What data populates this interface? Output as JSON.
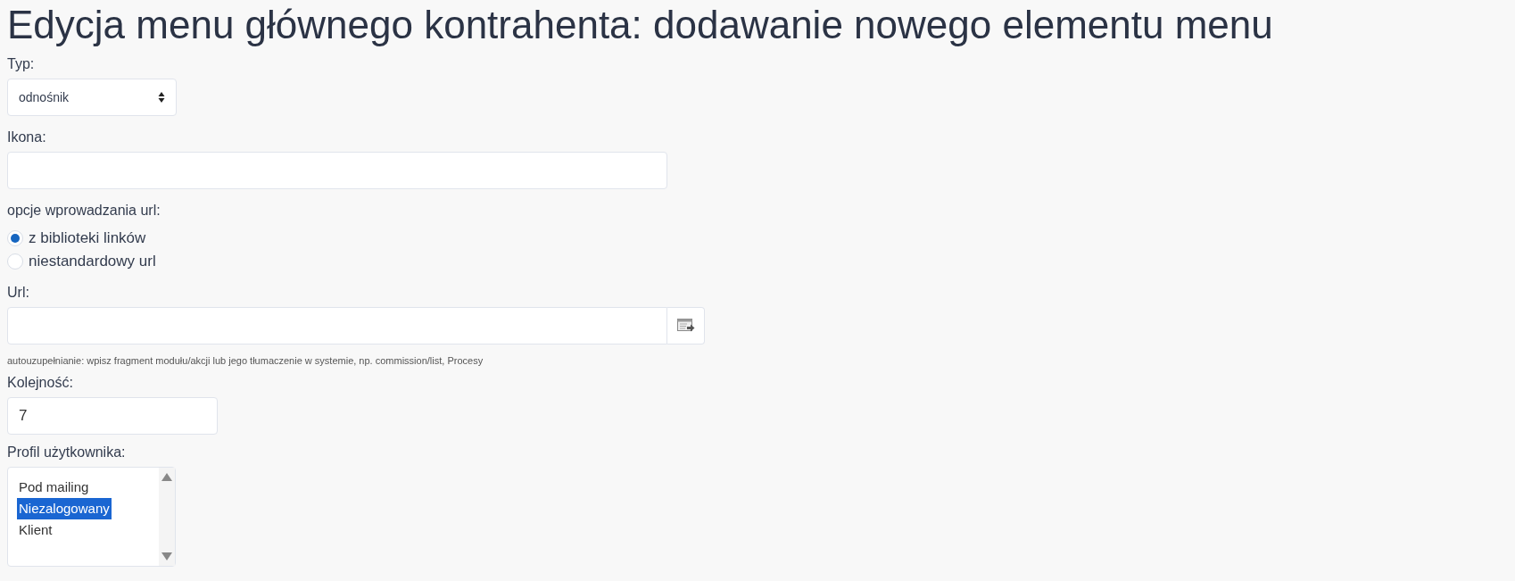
{
  "title": "Edycja menu głównego kontrahenta: dodawanie nowego elementu menu",
  "type_field": {
    "label": "Typ:",
    "value": "odnośnik"
  },
  "icon_field": {
    "label": "Ikona:"
  },
  "url_options": {
    "label": "opcje wprowadzania url:",
    "options": [
      {
        "label": "z biblioteki linków",
        "selected": true
      },
      {
        "label": "niestandardowy url",
        "selected": false
      }
    ]
  },
  "url_field": {
    "label": "Url:",
    "hint": "autouzupełnianie: wpisz fragment modułu/akcji lub jego tłumaczenie w systemie, np. commission/list, Procesy"
  },
  "order_field": {
    "label": "Kolejność:",
    "value": "7"
  },
  "profile_field": {
    "label": "Profil użytkownika:",
    "items": [
      {
        "label": "Pod mailing",
        "selected": false
      },
      {
        "label": "Niezalogowany",
        "selected": true
      },
      {
        "label": "Klient",
        "selected": false
      }
    ]
  }
}
